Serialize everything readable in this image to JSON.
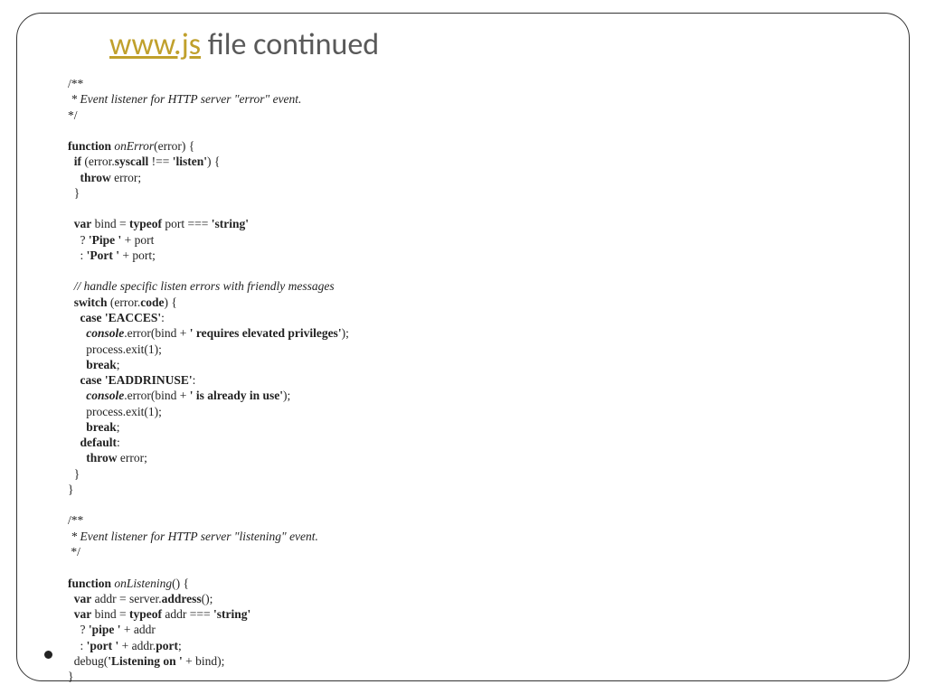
{
  "title": {
    "link_text": "www.js",
    "rest": " file continued"
  },
  "code": {
    "c1a": "/**",
    "c1b": " * Event listener for HTTP server \"error\" event.",
    "c1c": "*/",
    "l2a": "function",
    "l2b": " onError",
    "l2c": "(error) {",
    "l3a": "  if",
    "l3b": " (error.",
    "l3c": "syscall",
    "l3d": " !== ",
    "l3e": "'listen'",
    "l3f": ") {",
    "l4a": "    throw",
    "l4b": " error;",
    "l5": "  }",
    "l6a": "  var",
    "l6b": " bind = ",
    "l6c": "typeof",
    "l6d": " port === ",
    "l6e": "'string'",
    "l7a": "    ? ",
    "l7b": "'Pipe '",
    "l7c": " + port",
    "l8a": "    : ",
    "l8b": "'Port '",
    "l8c": " + port;",
    "c2": "  // handle specific listen errors with friendly messages",
    "l9a": "  switch",
    "l9b": " (error.",
    "l9c": "code",
    "l9d": ") {",
    "l10a": "    case",
    "l10b": " 'EACCES'",
    "l10c": ":",
    "l11a": "      console",
    "l11b": ".error(bind + ",
    "l11c": "' requires elevated privileges'",
    "l11d": ");",
    "l12": "      process.exit(1);",
    "l13a": "      break",
    "l13b": ";",
    "l14a": "    case",
    "l14b": " 'EADDRINUSE'",
    "l14c": ":",
    "l15a": "      console",
    "l15b": ".error(bind + ",
    "l15c": "' is already in use'",
    "l15d": ");",
    "l16": "      process.exit(1);",
    "l17a": "      break",
    "l17b": ";",
    "l18a": "    default",
    "l18b": ":",
    "l19a": "      throw",
    "l19b": " error;",
    "l20": "  }",
    "l21": "}",
    "c3a": "/**",
    "c3b": " * Event listener for HTTP server \"listening\" event.",
    "c3c": " */",
    "l22a": "function",
    "l22b": " onListening",
    "l22c": "() {",
    "l23a": "  var",
    "l23b": " addr = server.",
    "l23c": "address",
    "l23d": "();",
    "l24a": "  var",
    "l24b": " bind = ",
    "l24c": "typeof",
    "l24d": " addr === ",
    "l24e": "'string'",
    "l25a": "    ? ",
    "l25b": "'pipe '",
    "l25c": " + addr",
    "l26a": "    : ",
    "l26b": "'port '",
    "l26c": " + addr.",
    "l26d": "port",
    "l26e": ";",
    "l27a": "  debug(",
    "l27b": "'Listening on '",
    "l27c": " + bind);",
    "l28": "}"
  }
}
